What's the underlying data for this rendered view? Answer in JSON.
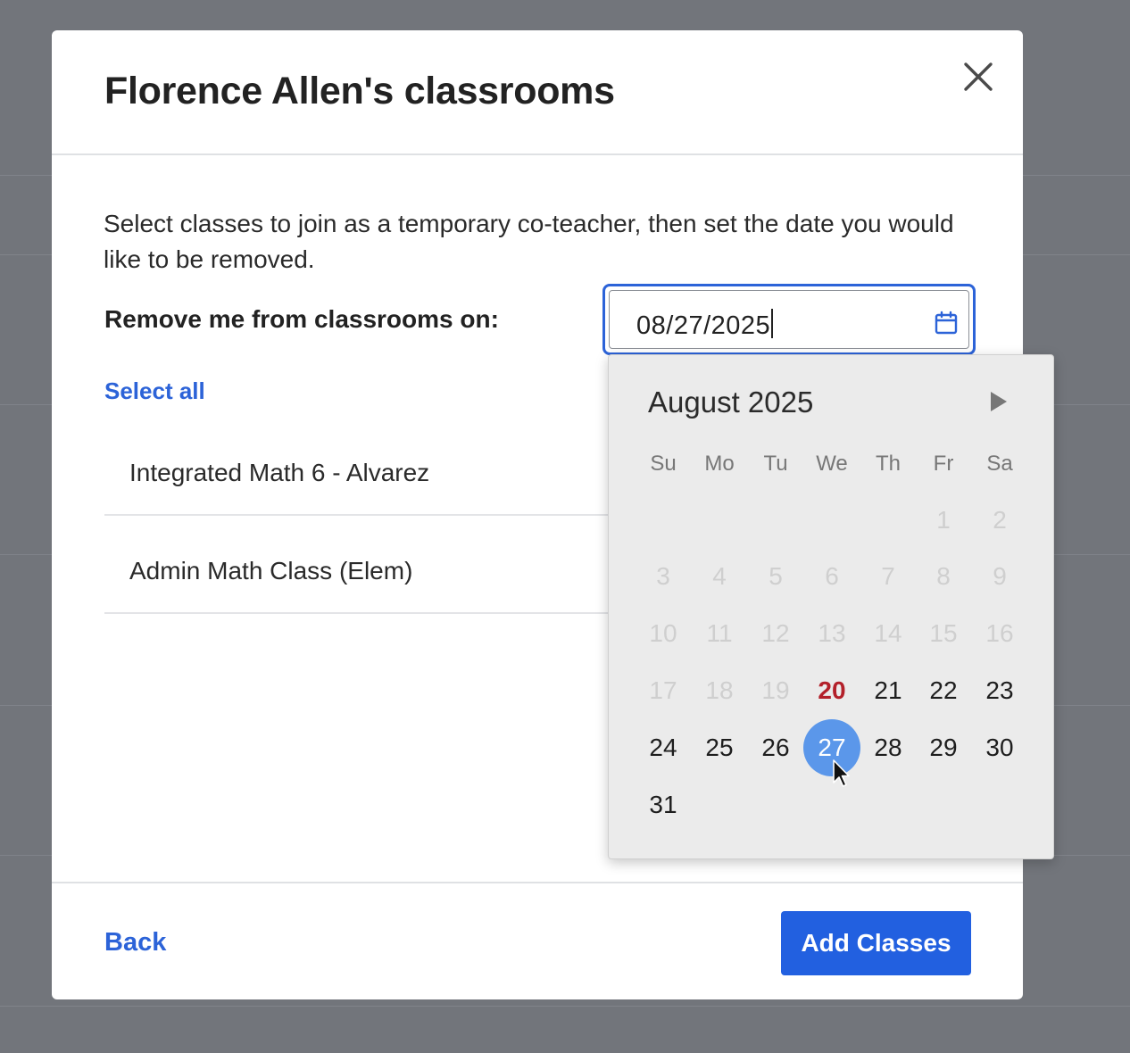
{
  "modal": {
    "title": "Florence Allen's classrooms",
    "description": "Select classes to join as a temporary co-teacher, then set the date you would like to be removed.",
    "remove_label": "Remove me from classrooms on:",
    "date_value": "08/27/2025",
    "select_all": "Select all",
    "classes": [
      {
        "name": "Integrated Math 6 - Alvarez"
      },
      {
        "name": "Admin Math Class (Elem)"
      }
    ],
    "back_label": "Back",
    "add_label": "Add Classes"
  },
  "calendar": {
    "month_label": "August 2025",
    "weekdays": [
      "Su",
      "Mo",
      "Tu",
      "We",
      "Th",
      "Fr",
      "Sa"
    ],
    "days": [
      "1",
      "2",
      "3",
      "4",
      "5",
      "6",
      "7",
      "8",
      "9",
      "10",
      "11",
      "12",
      "13",
      "14",
      "15",
      "16",
      "17",
      "18",
      "19",
      "20",
      "21",
      "22",
      "23",
      "24",
      "25",
      "26",
      "27",
      "28",
      "29",
      "30",
      "31"
    ],
    "first_weekday_index": 5,
    "today": "20",
    "selected": "27",
    "first_enabled_day": 20
  },
  "colors": {
    "accent": "#2c63d8",
    "primary_button": "#2260e0",
    "selected_day": "#5b97ea",
    "today_day": "#b3202a"
  },
  "icons": {
    "close": "close-icon",
    "calendar": "calendar-icon",
    "next_month": "chevron-right-icon",
    "pointer": "mouse-pointer-icon"
  }
}
